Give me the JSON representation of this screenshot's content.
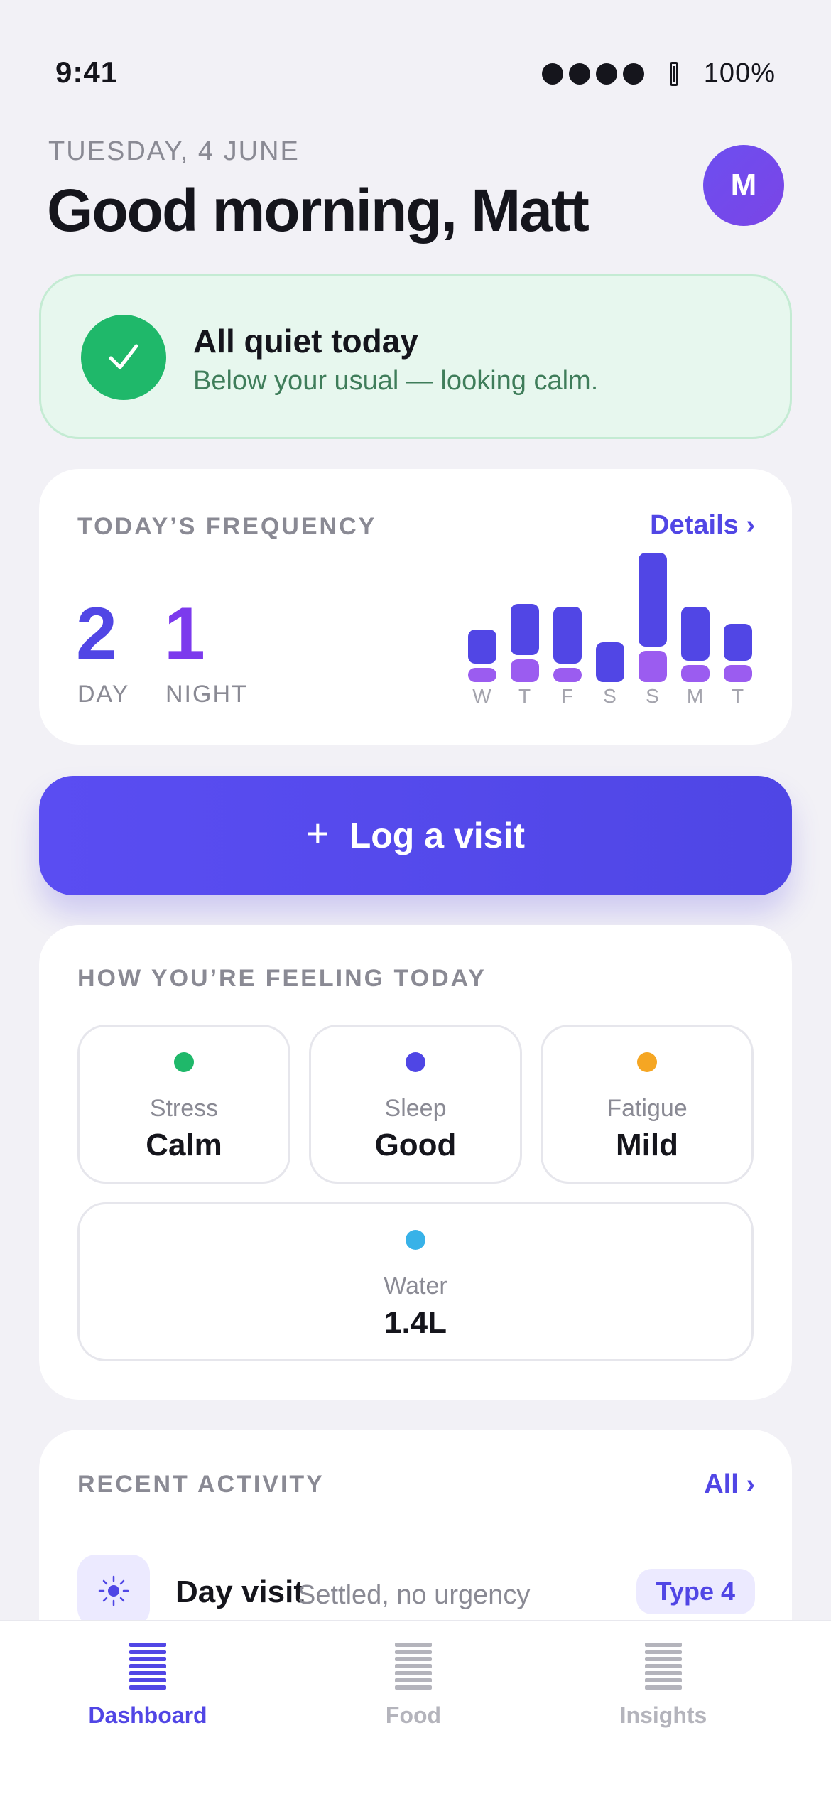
{
  "status_bar": {
    "time": "9:41",
    "battery": "100%"
  },
  "header": {
    "date": "TUESDAY, 4 JUNE",
    "greeting": "Good morning, Matt",
    "avatar_initial": "M"
  },
  "quiet_card": {
    "title": "All quiet today",
    "subtitle": "Below your usual — looking calm."
  },
  "frequency": {
    "label": "TODAY’S FREQUENCY",
    "details_link": "Details ›",
    "day_count": "2",
    "day_label": "DAY",
    "night_count": "1",
    "night_label": "NIGHT",
    "week": [
      {
        "day": "W",
        "day_level": 0.24,
        "night_level": 0.1
      },
      {
        "day": "T",
        "day_level": 0.36,
        "night_level": 0.16
      },
      {
        "day": "F",
        "day_level": 0.4,
        "night_level": 0.1
      },
      {
        "day": "S",
        "day_level": 0.28,
        "night_level": 0.0
      },
      {
        "day": "S",
        "day_level": 0.66,
        "night_level": 0.22
      },
      {
        "day": "M",
        "day_level": 0.38,
        "night_level": 0.12
      },
      {
        "day": "T",
        "day_level": 0.26,
        "night_level": 0.12
      }
    ]
  },
  "log_button": {
    "icon": "plus-icon",
    "label": "Log a visit"
  },
  "feeling": {
    "label": "HOW YOU’RE FEELING TODAY",
    "tiles": [
      {
        "label": "Stress",
        "value": "Calm",
        "color": "#1fb86a"
      },
      {
        "label": "Sleep",
        "value": "Good",
        "color": "#4f46e5"
      },
      {
        "label": "Fatigue",
        "value": "Mild",
        "color": "#f5a623"
      },
      {
        "label": "Water",
        "value": "1.4L",
        "color": "#38b2e8"
      }
    ]
  },
  "recent": {
    "label": "RECENT ACTIVITY",
    "all_link": "All ›",
    "items": [
      {
        "icon": "sun-icon",
        "title": "Day visit",
        "subtitle": "Settled, no urgency",
        "badge": "Type 4"
      }
    ]
  },
  "tabs": [
    {
      "label": "Dashboard",
      "icon": "list-icon",
      "active": true
    },
    {
      "label": "Food",
      "icon": "list-icon",
      "active": false
    },
    {
      "label": "Insights",
      "icon": "list-icon",
      "active": false
    }
  ],
  "colors": {
    "accent": "#5146e5",
    "night": "#9b5cf0",
    "success": "#1fb86a",
    "muted": "#8a8a94",
    "tab_inactive": "#b4b4bc"
  }
}
